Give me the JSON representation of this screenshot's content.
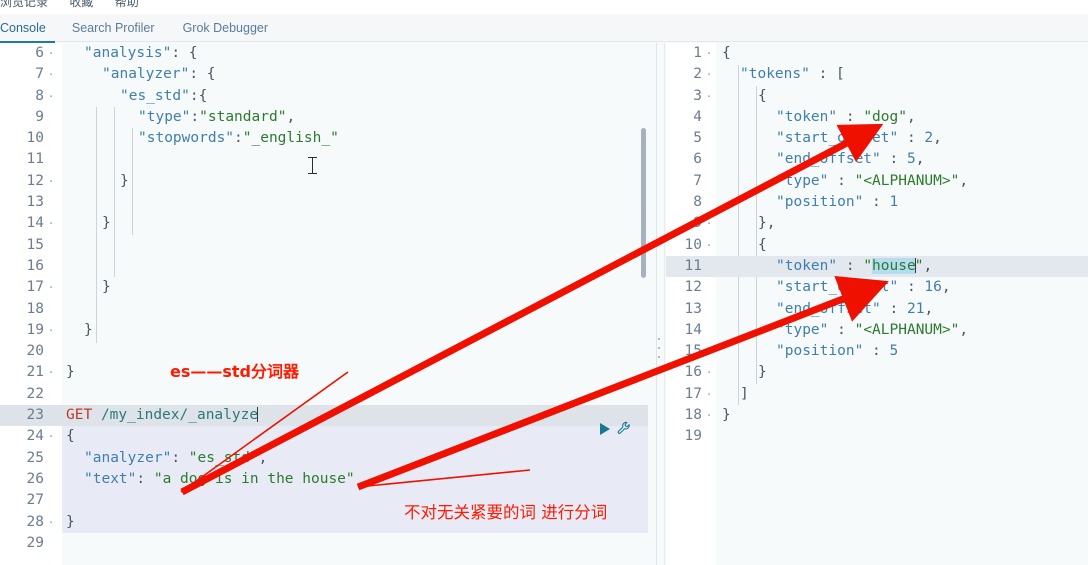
{
  "browser_chrome": {
    "cut_items": [
      "浏览记录",
      "收藏",
      "帮助"
    ]
  },
  "tabs": [
    {
      "label": "Console",
      "active": true
    },
    {
      "label": "Search Profiler",
      "active": false
    },
    {
      "label": "Grok Debugger",
      "active": false
    }
  ],
  "colors": {
    "accent": "#1e7ba6",
    "annotation_red": "#ff1a00",
    "json_key": "#3f7fad",
    "json_string": "#2d7a2f",
    "http_method": "#c0392b",
    "url": "#2c7a7a",
    "selection": "#b6dcf0",
    "active_line": "#dde3e9",
    "selected_block": "#e8ebf5"
  },
  "editor": {
    "name": "request-editor",
    "first_line_number": 6,
    "lines": [
      {
        "num": 6,
        "fold": "·",
        "indent": 1,
        "tokens": [
          {
            "t": "\"analysis\"",
            "c": "k"
          },
          {
            "t": ": {",
            "c": "p"
          }
        ]
      },
      {
        "num": 7,
        "fold": "·",
        "indent": 2,
        "tokens": [
          {
            "t": "\"analyzer\"",
            "c": "k"
          },
          {
            "t": ": {",
            "c": "p"
          }
        ]
      },
      {
        "num": 8,
        "fold": "·",
        "indent": 3,
        "tokens": [
          {
            "t": "\"es_std\"",
            "c": "k"
          },
          {
            "t": ":{",
            "c": "p"
          }
        ]
      },
      {
        "num": 9,
        "fold": "",
        "indent": 4,
        "tokens": [
          {
            "t": "\"type\"",
            "c": "k"
          },
          {
            "t": ":",
            "c": "p"
          },
          {
            "t": "\"standard\"",
            "c": "s"
          },
          {
            "t": ",",
            "c": "p"
          }
        ]
      },
      {
        "num": 10,
        "fold": "",
        "indent": 4,
        "tokens": [
          {
            "t": "\"stopwords\"",
            "c": "k"
          },
          {
            "t": ":",
            "c": "p"
          },
          {
            "t": "\"_english_\"",
            "c": "s"
          }
        ]
      },
      {
        "num": 11,
        "fold": "",
        "indent": 0,
        "tokens": []
      },
      {
        "num": 12,
        "fold": "·",
        "indent": 3,
        "tokens": [
          {
            "t": "}",
            "c": "p"
          }
        ]
      },
      {
        "num": 13,
        "fold": "",
        "indent": 0,
        "tokens": []
      },
      {
        "num": 14,
        "fold": "·",
        "indent": 2,
        "tokens": [
          {
            "t": "}",
            "c": "p"
          }
        ]
      },
      {
        "num": 15,
        "fold": "",
        "indent": 0,
        "tokens": []
      },
      {
        "num": 16,
        "fold": "",
        "indent": 0,
        "tokens": []
      },
      {
        "num": 17,
        "fold": "·",
        "indent": 2,
        "tokens": [
          {
            "t": "}",
            "c": "p"
          }
        ]
      },
      {
        "num": 18,
        "fold": "",
        "indent": 0,
        "tokens": []
      },
      {
        "num": 19,
        "fold": "·",
        "indent": 1,
        "tokens": [
          {
            "t": "}",
            "c": "p"
          }
        ]
      },
      {
        "num": 20,
        "fold": "",
        "indent": 0,
        "tokens": []
      },
      {
        "num": 21,
        "fold": "·",
        "indent": 0,
        "tokens": [
          {
            "t": "}",
            "c": "p"
          }
        ]
      },
      {
        "num": 22,
        "fold": "",
        "indent": 0,
        "tokens": []
      },
      {
        "num": 23,
        "fold": "",
        "indent": 0,
        "state": "active-line",
        "tokens": [
          {
            "t": "GET",
            "c": "m"
          },
          {
            "t": " ",
            "c": "p"
          },
          {
            "t": "/my_index/_analyze",
            "c": "u"
          },
          {
            "t": "|caret|",
            "c": "caret"
          }
        ]
      },
      {
        "num": 24,
        "fold": "·",
        "indent": 0,
        "state": "sel-block",
        "tokens": [
          {
            "t": "{",
            "c": "p"
          }
        ]
      },
      {
        "num": 25,
        "fold": "",
        "indent": 1,
        "state": "sel-block",
        "tokens": [
          {
            "t": "\"analyzer\"",
            "c": "k"
          },
          {
            "t": ": ",
            "c": "p"
          },
          {
            "t": "\"es_std\"",
            "c": "s"
          },
          {
            "t": ",",
            "c": "p"
          }
        ]
      },
      {
        "num": 26,
        "fold": "",
        "indent": 1,
        "state": "sel-block",
        "tokens": [
          {
            "t": "\"text\"",
            "c": "k"
          },
          {
            "t": ": ",
            "c": "p"
          },
          {
            "t": "\"a dog is in the house\"",
            "c": "s"
          }
        ]
      },
      {
        "num": 27,
        "fold": "",
        "indent": 0,
        "state": "sel-block",
        "tokens": []
      },
      {
        "num": 28,
        "fold": "·",
        "indent": 0,
        "state": "sel-block",
        "tokens": [
          {
            "t": "}",
            "c": "p"
          }
        ]
      },
      {
        "num": 29,
        "fold": "",
        "indent": 0,
        "tokens": []
      }
    ]
  },
  "output": {
    "name": "response-viewer",
    "first_line_number": 1,
    "lines": [
      {
        "num": 1,
        "fold": "·",
        "indent": 0,
        "tokens": [
          {
            "t": "{",
            "c": "p"
          }
        ]
      },
      {
        "num": 2,
        "fold": "·",
        "indent": 1,
        "tokens": [
          {
            "t": "\"tokens\"",
            "c": "k"
          },
          {
            "t": " : [",
            "c": "p"
          }
        ]
      },
      {
        "num": 3,
        "fold": "·",
        "indent": 2,
        "tokens": [
          {
            "t": "{",
            "c": "p"
          }
        ]
      },
      {
        "num": 4,
        "fold": "",
        "indent": 3,
        "tokens": [
          {
            "t": "\"token\"",
            "c": "k"
          },
          {
            "t": " : ",
            "c": "p"
          },
          {
            "t": "\"dog\"",
            "c": "s"
          },
          {
            "t": ",",
            "c": "p"
          }
        ]
      },
      {
        "num": 5,
        "fold": "",
        "indent": 3,
        "tokens": [
          {
            "t": "\"start_offset\"",
            "c": "k"
          },
          {
            "t": " : ",
            "c": "p"
          },
          {
            "t": "2",
            "c": "n"
          },
          {
            "t": ",",
            "c": "p"
          }
        ]
      },
      {
        "num": 6,
        "fold": "",
        "indent": 3,
        "tokens": [
          {
            "t": "\"end_offset\"",
            "c": "k"
          },
          {
            "t": " : ",
            "c": "p"
          },
          {
            "t": "5",
            "c": "n"
          },
          {
            "t": ",",
            "c": "p"
          }
        ]
      },
      {
        "num": 7,
        "fold": "",
        "indent": 3,
        "tokens": [
          {
            "t": "\"type\"",
            "c": "k"
          },
          {
            "t": " : ",
            "c": "p"
          },
          {
            "t": "\"<ALPHANUM>\"",
            "c": "s"
          },
          {
            "t": ",",
            "c": "p"
          }
        ]
      },
      {
        "num": 8,
        "fold": "",
        "indent": 3,
        "tokens": [
          {
            "t": "\"position\"",
            "c": "k"
          },
          {
            "t": " : ",
            "c": "p"
          },
          {
            "t": "1",
            "c": "n"
          }
        ]
      },
      {
        "num": 9,
        "fold": "·",
        "indent": 2,
        "tokens": [
          {
            "t": "},",
            "c": "p"
          }
        ]
      },
      {
        "num": 10,
        "fold": "·",
        "indent": 2,
        "tokens": [
          {
            "t": "{",
            "c": "p"
          }
        ]
      },
      {
        "num": 11,
        "fold": "",
        "indent": 3,
        "state": "hl-line",
        "tokens": [
          {
            "t": "\"token\"",
            "c": "k"
          },
          {
            "t": " : ",
            "c": "p"
          },
          {
            "t": "\"",
            "c": "s"
          },
          {
            "t": "house",
            "c": "s sel-txt"
          },
          {
            "t": "|caret|",
            "c": "caret"
          },
          {
            "t": "\"",
            "c": "s"
          },
          {
            "t": ",",
            "c": "p"
          }
        ]
      },
      {
        "num": 12,
        "fold": "",
        "indent": 3,
        "tokens": [
          {
            "t": "\"start_offset\"",
            "c": "k"
          },
          {
            "t": " : ",
            "c": "p"
          },
          {
            "t": "16",
            "c": "n"
          },
          {
            "t": ",",
            "c": "p"
          }
        ]
      },
      {
        "num": 13,
        "fold": "",
        "indent": 3,
        "tokens": [
          {
            "t": "\"end_offset\"",
            "c": "k"
          },
          {
            "t": " : ",
            "c": "p"
          },
          {
            "t": "21",
            "c": "n"
          },
          {
            "t": ",",
            "c": "p"
          }
        ]
      },
      {
        "num": 14,
        "fold": "",
        "indent": 3,
        "tokens": [
          {
            "t": "\"type\"",
            "c": "k"
          },
          {
            "t": " : ",
            "c": "p"
          },
          {
            "t": "\"<ALPHANUM>\"",
            "c": "s"
          },
          {
            "t": ",",
            "c": "p"
          }
        ]
      },
      {
        "num": 15,
        "fold": "",
        "indent": 3,
        "tokens": [
          {
            "t": "\"position\"",
            "c": "k"
          },
          {
            "t": " : ",
            "c": "p"
          },
          {
            "t": "5",
            "c": "n"
          }
        ]
      },
      {
        "num": 16,
        "fold": "·",
        "indent": 2,
        "tokens": [
          {
            "t": "}",
            "c": "p"
          }
        ]
      },
      {
        "num": 17,
        "fold": "·",
        "indent": 1,
        "tokens": [
          {
            "t": "]",
            "c": "p"
          }
        ]
      },
      {
        "num": 18,
        "fold": "·",
        "indent": 0,
        "tokens": [
          {
            "t": "}",
            "c": "p"
          }
        ]
      },
      {
        "num": 19,
        "fold": "",
        "indent": 0,
        "tokens": []
      }
    ]
  },
  "controls": {
    "play_label": "▶",
    "play_name": "play-icon",
    "wrench_label": "🔧",
    "wrench_name": "wrench-icon"
  },
  "annotations": [
    {
      "text": "es——std分词器",
      "name": "annotation-es-std"
    },
    {
      "text": "不对无关紧要的词 进行分词",
      "name": "annotation-stopwords"
    }
  ]
}
